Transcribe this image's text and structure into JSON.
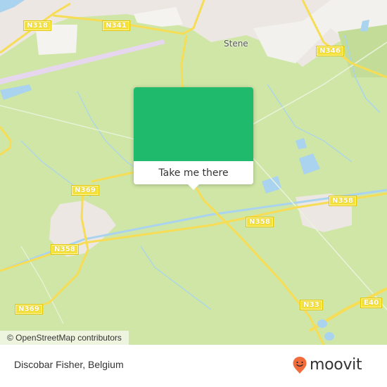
{
  "map": {
    "colors": {
      "land": "#cfe6a6",
      "urban": "#ece7e2",
      "water": "#a9d3ef",
      "road_major": "#f7dd55",
      "runway": "#e6d7ef",
      "accent": "#1fba6b",
      "brand": "#f26b3a"
    },
    "place_labels": [
      {
        "name": "Stene"
      }
    ],
    "road_shields": [
      {
        "ref": "N318"
      },
      {
        "ref": "N341"
      },
      {
        "ref": "N346"
      },
      {
        "ref": "N369"
      },
      {
        "ref": "N358"
      },
      {
        "ref": "N358"
      },
      {
        "ref": "N358"
      },
      {
        "ref": "N369"
      },
      {
        "ref": "N33"
      },
      {
        "ref": "E40"
      }
    ],
    "attribution": "© OpenStreetMap contributors"
  },
  "popup": {
    "button_label": "Take me there"
  },
  "footer": {
    "location_title": "Discobar Fisher, Belgium",
    "brand_name": "moovit"
  }
}
